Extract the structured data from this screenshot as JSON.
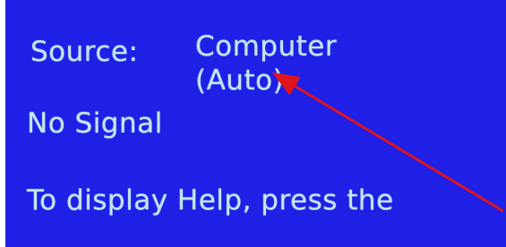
{
  "screen": {
    "background_color": "#1f1fe6",
    "text_color": "#bfe7ee",
    "source_label": "Source:",
    "source_value": "Computer",
    "source_mode": "(Auto)",
    "status": "No Signal",
    "help_text": "To display Help, press the"
  },
  "annotation": {
    "type": "arrow",
    "color": "#e0141b",
    "icon": "red-arrow-icon"
  }
}
